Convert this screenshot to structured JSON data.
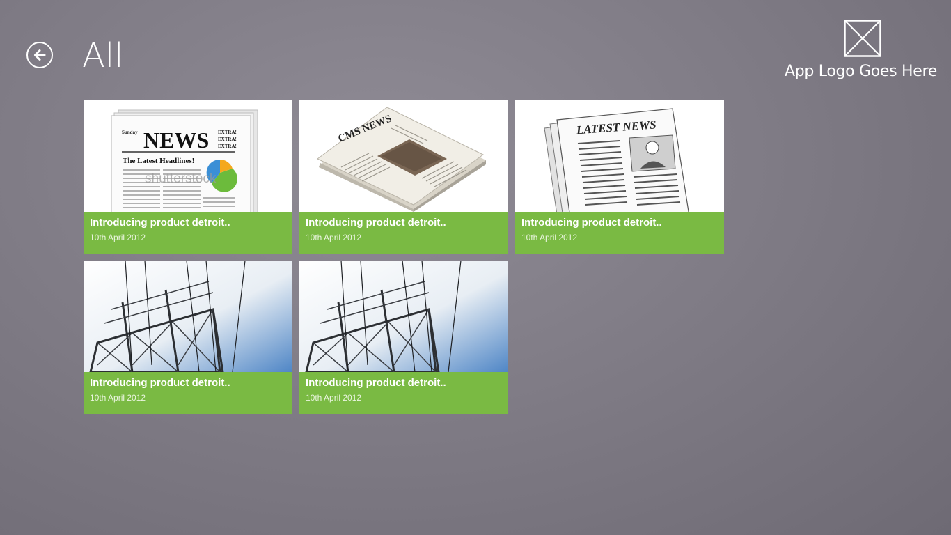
{
  "header": {
    "title": "All",
    "logo_text": "App Logo Goes Here"
  },
  "tiles": [
    {
      "title": "Introducing product detroit..",
      "date": "10th April 2012",
      "image": "news-paper-chart-image"
    },
    {
      "title": "Introducing product detroit..",
      "date": "10th April 2012",
      "image": "folded-newspaper-image"
    },
    {
      "title": "Introducing product detroit..",
      "date": "10th April 2012",
      "image": "latest-news-paper-image"
    },
    {
      "title": "Introducing product detroit..",
      "date": "10th April 2012",
      "image": "power-tower-image"
    },
    {
      "title": "Introducing product detroit..",
      "date": "10th April 2012",
      "image": "power-tower-image"
    }
  ],
  "image_text": {
    "news_headline": "NEWS",
    "news_extra": "EXTRA!",
    "news_sunday": "Sunday",
    "news_sub": "The Latest Headlines!",
    "news_watermark": "shutterstock",
    "latest_news": "LATEST NEWS",
    "folded_masthead": "CMS NEWS"
  },
  "colors": {
    "tile_accent": "#7aba43",
    "background": "#7d7983",
    "text": "#ffffff"
  },
  "icons": {
    "back": "back-arrow-icon",
    "logo": "logo-placeholder-icon"
  }
}
